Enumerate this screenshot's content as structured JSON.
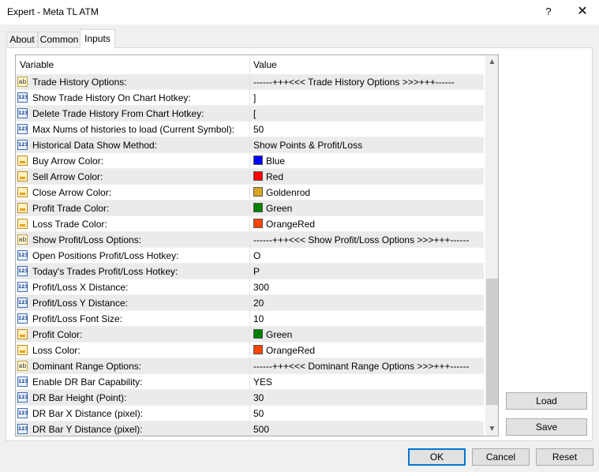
{
  "window": {
    "title": "Expert - Meta TL ATM",
    "help": "?",
    "close": "✕"
  },
  "tabs": [
    {
      "label": "About"
    },
    {
      "label": "Common"
    },
    {
      "label": "Inputs"
    }
  ],
  "grid": {
    "headers": {
      "variable": "Variable",
      "value": "Value"
    },
    "rows": [
      {
        "type": "ab",
        "variable": "Trade History Options:",
        "value": "------+++<<< Trade History Options >>>+++------"
      },
      {
        "type": "123",
        "variable": "Show Trade History On Chart Hotkey:",
        "value": "]"
      },
      {
        "type": "123",
        "variable": "Delete Trade History From Chart Hotkey:",
        "value": "["
      },
      {
        "type": "123",
        "variable": "Max Nums of histories to load (Current Symbol):",
        "value": "50"
      },
      {
        "type": "123",
        "variable": "Historical Data Show Method:",
        "value": "Show Points & Profit/Loss"
      },
      {
        "type": "color",
        "variable": "Buy Arrow Color:",
        "value": "Blue",
        "color": "#0000ff"
      },
      {
        "type": "color",
        "variable": "Sell Arrow Color:",
        "value": "Red",
        "color": "#ff0000"
      },
      {
        "type": "color",
        "variable": "Close Arrow Color:",
        "value": "Goldenrod",
        "color": "#daa520"
      },
      {
        "type": "color",
        "variable": "Profit Trade Color:",
        "value": "Green",
        "color": "#008000"
      },
      {
        "type": "color",
        "variable": "Loss Trade Color:",
        "value": "OrangeRed",
        "color": "#ff4500"
      },
      {
        "type": "ab",
        "variable": "Show Profit/Loss Options:",
        "value": "------+++<<< Show Profit/Loss Options >>>+++------"
      },
      {
        "type": "123",
        "variable": "Open Positions Profit/Loss Hotkey:",
        "value": "O"
      },
      {
        "type": "123",
        "variable": "Today's Trades Profit/Loss Hotkey:",
        "value": "P"
      },
      {
        "type": "123",
        "variable": "Profit/Loss X Distance:",
        "value": "300"
      },
      {
        "type": "123",
        "variable": "Profit/Loss Y Distance:",
        "value": "20"
      },
      {
        "type": "123",
        "variable": "Profit/Loss Font Size:",
        "value": "10"
      },
      {
        "type": "color",
        "variable": "Profit Color:",
        "value": "Green",
        "color": "#008000"
      },
      {
        "type": "color",
        "variable": "Loss Color:",
        "value": "OrangeRed",
        "color": "#ff4500"
      },
      {
        "type": "ab",
        "variable": "Dominant Range Options:",
        "value": "------+++<<< Dominant Range Options >>>+++------"
      },
      {
        "type": "123",
        "variable": "Enable DR Bar Capability:",
        "value": "YES"
      },
      {
        "type": "123",
        "variable": "DR Bar Height (Point):",
        "value": "30"
      },
      {
        "type": "123",
        "variable": "DR Bar X Distance (pixel):",
        "value": "50"
      },
      {
        "type": "123",
        "variable": "DR Bar Y Distance (pixel):",
        "value": "500"
      }
    ]
  },
  "side_buttons": {
    "load": "Load",
    "save": "Save"
  },
  "footer_buttons": {
    "ok": "OK",
    "cancel": "Cancel",
    "reset": "Reset"
  }
}
